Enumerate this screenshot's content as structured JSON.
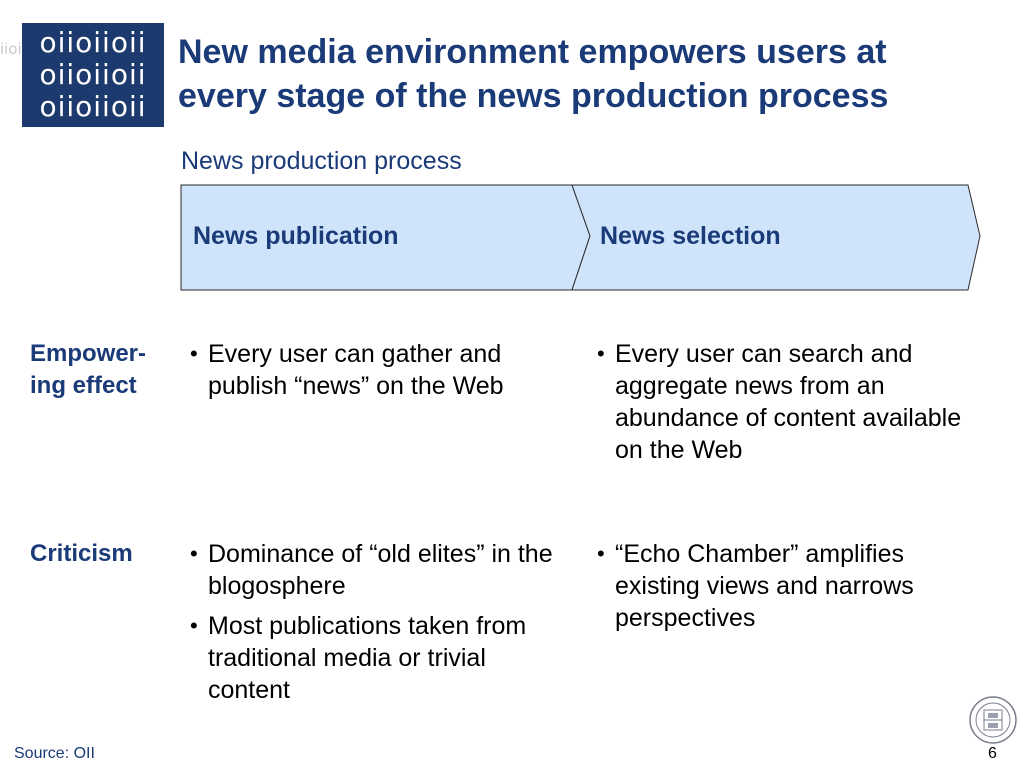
{
  "header": {
    "logo": {
      "icon": "binary-oii-logo-icon",
      "lines": [
        "oiioiioii",
        "oiioiioii",
        "oiioiioii"
      ],
      "ghost_text": "iioi"
    },
    "title_line1": "New media environment empowers users at",
    "title_line2": "every stage of the news production process",
    "subtitle": "News production process"
  },
  "stages": [
    {
      "label": "News publication"
    },
    {
      "label": "News selection"
    }
  ],
  "rows": [
    {
      "label_line1": "Empower-",
      "label_line2": "ing effect",
      "col1": [
        "Every user can gather and publish “news” on the Web"
      ],
      "col2": [
        "Every user can search and aggregate news from an abundance of content available on the Web"
      ]
    },
    {
      "label_line1": "Criticism",
      "col1": [
        "Dominance of “old elites” in the blogosphere",
        "Most publications taken from traditional media or trivial content"
      ],
      "col2": [
        "“Echo Chamber” amplifies existing views and narrows perspectives"
      ]
    }
  ],
  "footer": {
    "source": "Source:  OII",
    "page_number": "6",
    "seal_icon": "university-seal-icon"
  },
  "colors": {
    "accent": "#1a3a78",
    "chevron_fill": "#cfe3fb",
    "logo_bg": "#1d3a6e"
  }
}
